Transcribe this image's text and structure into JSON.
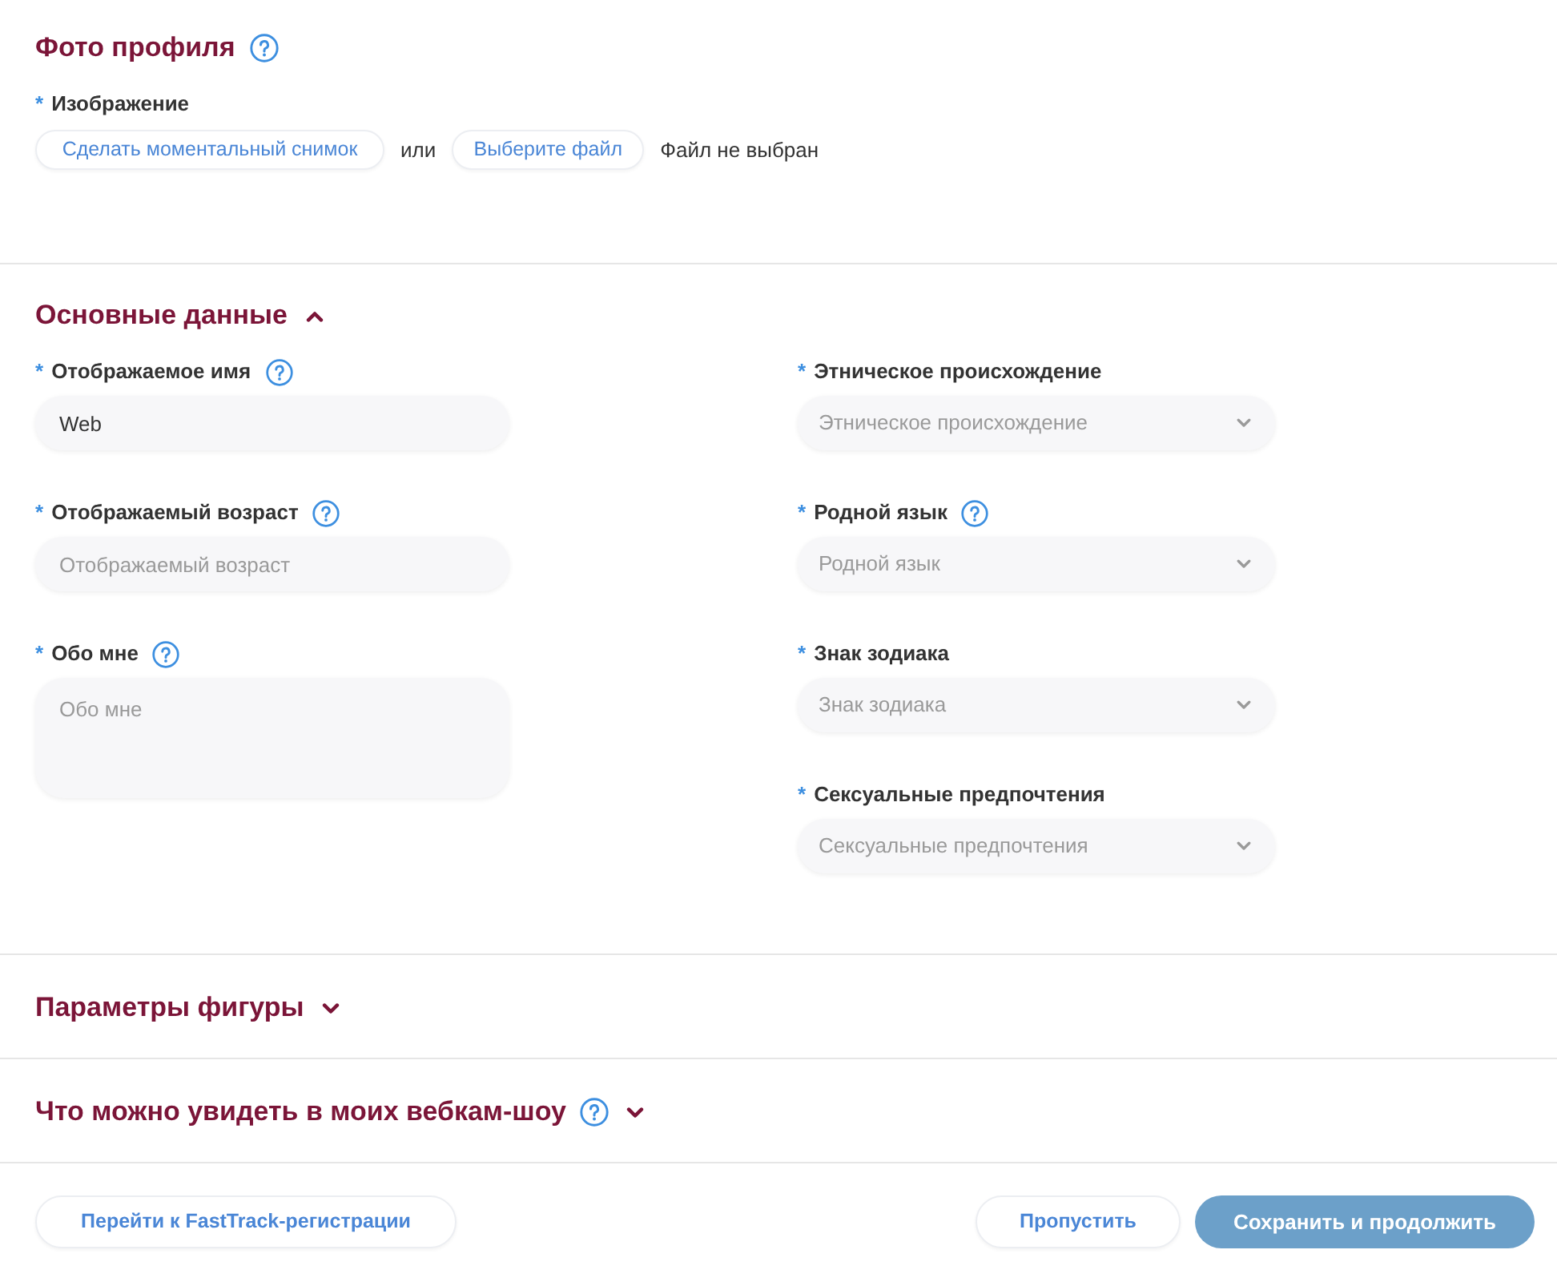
{
  "sections": [
    {
      "kind": "photo",
      "title": "Фото профиля",
      "help": true,
      "field": {
        "required_mark": "*",
        "label": "Изображение"
      },
      "buttons": [
        "Сделать моментальный снимок",
        "Выберите файл"
      ],
      "separator": "или",
      "file_status": "Файл не выбран"
    },
    {
      "kind": "group",
      "title": "Основные данные",
      "expanded": true,
      "columns": [
        [
          {
            "kind": "text",
            "required_mark": "*",
            "label": "Отображаемое имя",
            "help": true,
            "value": "Web"
          },
          {
            "kind": "text",
            "required_mark": "*",
            "label": "Отображаемый возраст",
            "help": true,
            "placeholder": "Отображаемый возраст"
          },
          {
            "kind": "textarea",
            "required_mark": "*",
            "label": "Обо мне",
            "help": true,
            "placeholder": "Обо мне"
          }
        ],
        [
          {
            "kind": "select",
            "required_mark": "*",
            "label": "Этническое происхождение",
            "placeholder": "Этническое происхождение"
          },
          {
            "kind": "select",
            "required_mark": "*",
            "label": "Родной язык",
            "help": true,
            "placeholder": "Родной язык"
          },
          {
            "kind": "select",
            "required_mark": "*",
            "label": "Знак зодиака",
            "placeholder": "Знак зодиака"
          },
          {
            "kind": "select",
            "required_mark": "*",
            "label": "Сексуальные предпочтения",
            "placeholder": "Сексуальные предпочтения"
          }
        ]
      ]
    },
    {
      "kind": "group",
      "title": "Параметры фигуры",
      "expanded": false
    },
    {
      "kind": "group",
      "title": "Что можно увидеть в моих вебкам-шоу",
      "help": true,
      "expanded": false
    }
  ],
  "footer": {
    "left_buttons": [
      {
        "kind": "outline",
        "label": "Перейти к FastTrack-регистрации"
      }
    ],
    "right_buttons": [
      {
        "kind": "outline",
        "label": "Пропустить"
      },
      {
        "kind": "primary",
        "label": "Сохранить и продолжить"
      }
    ]
  }
}
